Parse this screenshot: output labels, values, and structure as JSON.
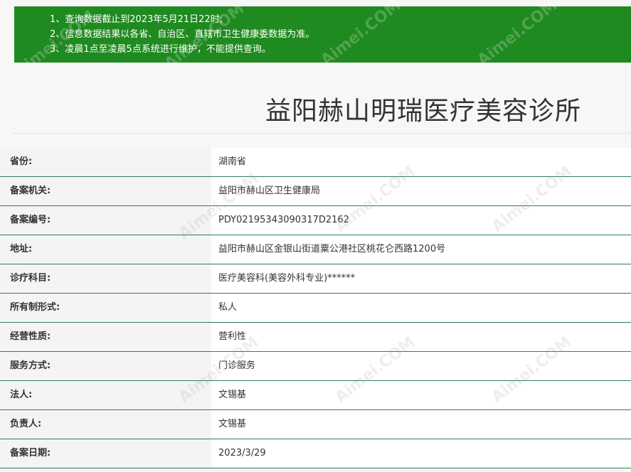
{
  "notice": {
    "lines": [
      "1、查询数据截止到2023年5月21日22时;",
      "2、信息数据结果以各省、自治区、直辖市卫生健康委数据为准。",
      "3、凌晨1点至凌晨5点系统进行维护，不能提供查询。"
    ],
    "background": "#1f8a1f"
  },
  "clinic": {
    "title": "益阳赫山明瑞医疗美容诊所"
  },
  "details": {
    "rows": [
      {
        "label": "省份:",
        "value": "湖南省"
      },
      {
        "label": "备案机关:",
        "value": "益阳市赫山区卫生健康局"
      },
      {
        "label": "备案编号:",
        "value": "PDY02195343090317D2162"
      },
      {
        "label": "地址:",
        "value": "益阳市赫山区金银山街道粟公港社区桃花仑西路1200号"
      },
      {
        "label": "诊疗科目:",
        "value": "医疗美容科(美容外科专业)******"
      },
      {
        "label": "所有制形式:",
        "value": "私人"
      },
      {
        "label": "经营性质:",
        "value": "营利性"
      },
      {
        "label": "服务方式:",
        "value": "门诊服务"
      },
      {
        "label": "法人:",
        "value": "文锡基"
      },
      {
        "label": "负责人:",
        "value": "文锡基"
      },
      {
        "label": "备案日期:",
        "value": "2023/3/29"
      }
    ],
    "border_color": "#2e7d5b"
  },
  "watermark": {
    "text": "Aimei.COM"
  }
}
